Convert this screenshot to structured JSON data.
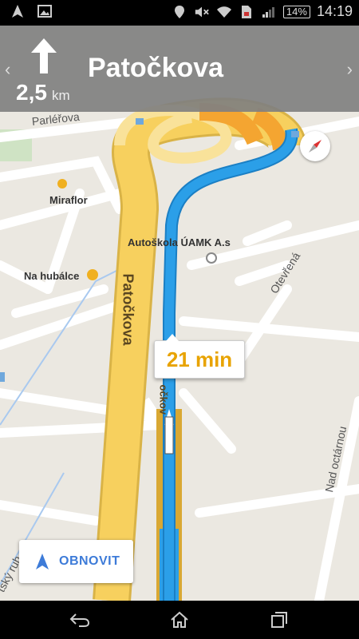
{
  "status_bar": {
    "time": "14:19",
    "battery": "14%",
    "icons": [
      "navigation-icon",
      "image-icon",
      "location-icon",
      "mute-icon",
      "wifi-icon",
      "sim-icon",
      "signal-icon"
    ]
  },
  "nav": {
    "distance_value": "2,5",
    "distance_unit": "km",
    "street": "Patočkova",
    "direction_icon": "arrow-up-icon",
    "prev_icon": "chevron-left-icon",
    "next_icon": "chevron-right-icon"
  },
  "map": {
    "places": [
      "Miraflor",
      "Na hubálce",
      "Autoškola ÚAMK A.s"
    ],
    "streets": [
      "Parléřova",
      "Patočkova",
      "Otevřená",
      "Nad octárnou",
      "tský ruh",
      "očkov"
    ]
  },
  "eta": "21 min",
  "recenter_label": "OBNOVIT",
  "colors": {
    "route_blue": "#2b9fe8",
    "main_road": "#f7d05e",
    "orange": "#f4a531",
    "nav_bg": "#8a8a8a",
    "eta_text": "#e8a300",
    "accent": "#3d7bd8"
  },
  "navbar": [
    "back-icon",
    "home-icon",
    "recents-icon"
  ]
}
